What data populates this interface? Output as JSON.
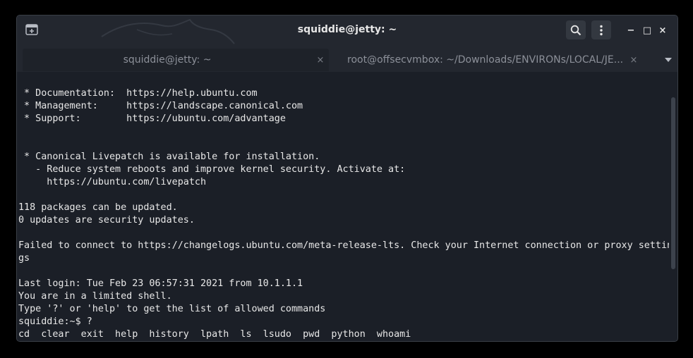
{
  "window": {
    "title": "squiddie@jetty: ~"
  },
  "tabs": [
    {
      "label": "squiddie@jetty: ~",
      "close": "×",
      "active": true
    },
    {
      "label": "root@offsecvmbox: ~/Downloads/ENVIRONs/LOCAL/JE...",
      "close": "×",
      "active": false
    }
  ],
  "icons": {
    "new_tab": "new-tab-icon",
    "search": "search-icon",
    "menu": "kebab-menu-icon",
    "minimize": "minimize-icon",
    "maximize": "maximize-icon",
    "close": "close-icon",
    "tab_dropdown": "chevron-down-icon"
  },
  "controls": {
    "minimize": "−",
    "maximize": "□",
    "close": "×"
  },
  "terminal": {
    "lines": [
      " * Documentation:  https://help.ubuntu.com",
      " * Management:     https://landscape.canonical.com",
      " * Support:        https://ubuntu.com/advantage",
      "",
      "",
      " * Canonical Livepatch is available for installation.",
      "   - Reduce system reboots and improve kernel security. Activate at:",
      "     https://ubuntu.com/livepatch",
      "",
      "118 packages can be updated.",
      "0 updates are security updates.",
      "",
      "Failed to connect to https://changelogs.ubuntu.com/meta-release-lts. Check your Internet connection or proxy settin",
      "gs",
      "",
      "Last login: Tue Feb 23 06:57:31 2021 from 10.1.1.1",
      "You are in a limited shell.",
      "Type '?' or 'help' to get the list of allowed commands",
      "squiddie:~$ ?",
      "cd  clear  exit  help  history  lpath  ls  lsudo  pwd  python  whoami"
    ]
  },
  "colors": {
    "background": "#1b1f27",
    "titlebar": "#23272f",
    "text": "#e8e8e8"
  }
}
